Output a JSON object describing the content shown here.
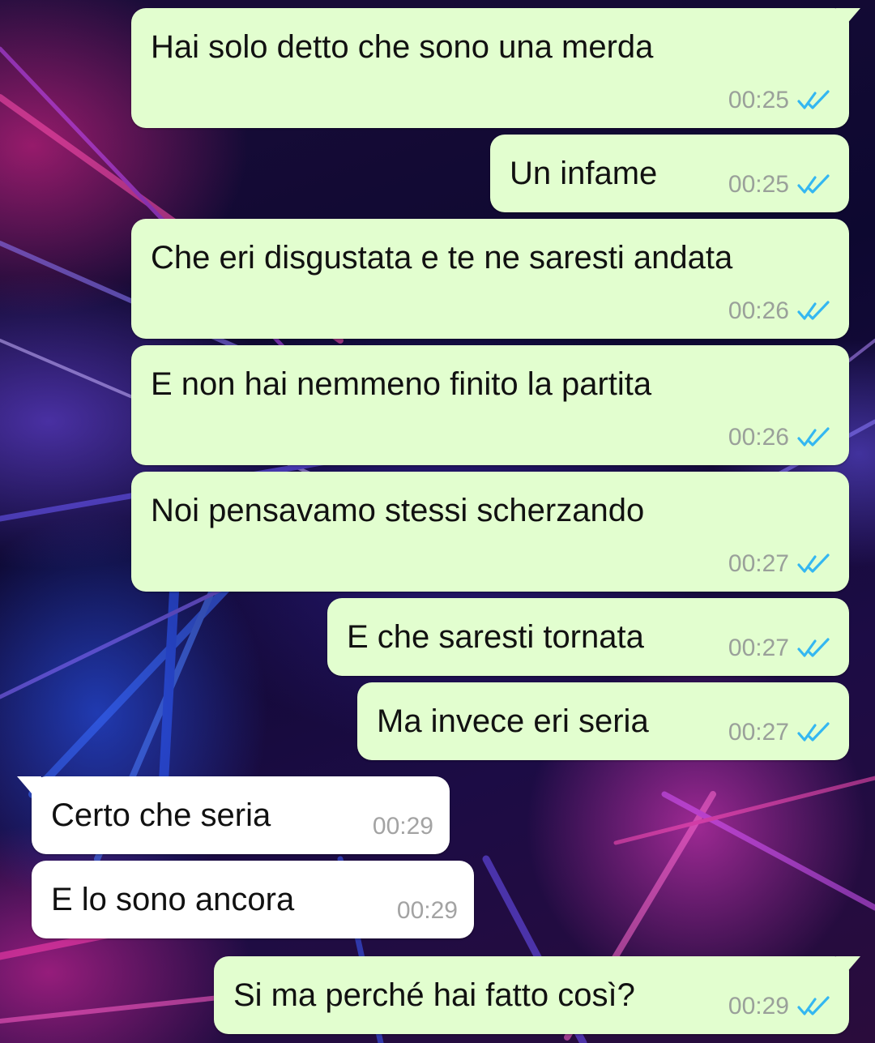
{
  "chat": {
    "messages": [
      {
        "direction": "outgoing",
        "text": "Hai solo detto che sono una merda",
        "time": "00:25",
        "status": "read"
      },
      {
        "direction": "outgoing",
        "text": "Un infame",
        "time": "00:25",
        "status": "read"
      },
      {
        "direction": "outgoing",
        "text": "Che eri disgustata e te ne saresti andata",
        "time": "00:26",
        "status": "read"
      },
      {
        "direction": "outgoing",
        "text": "E non hai nemmeno finito la partita",
        "time": "00:26",
        "status": "read"
      },
      {
        "direction": "outgoing",
        "text": "Noi pensavamo stessi scherzando",
        "time": "00:27",
        "status": "read"
      },
      {
        "direction": "outgoing",
        "text": "E che saresti tornata",
        "time": "00:27",
        "status": "read"
      },
      {
        "direction": "outgoing",
        "text": "Ma invece eri seria",
        "time": "00:27",
        "status": "read"
      },
      {
        "direction": "incoming",
        "text": "Certo che seria",
        "time": "00:29"
      },
      {
        "direction": "incoming",
        "text": "E lo sono ancora",
        "time": "00:29"
      },
      {
        "direction": "outgoing",
        "text": "Si ma perché hai fatto così?",
        "time": "00:29",
        "status": "read"
      }
    ]
  },
  "colors": {
    "outgoing_bubble": "#e2fecf",
    "incoming_bubble": "#ffffff",
    "read_ticks": "#34b7f1",
    "timestamp": "#9aa09a"
  },
  "icons": {
    "read_receipt": "double-check-icon"
  }
}
